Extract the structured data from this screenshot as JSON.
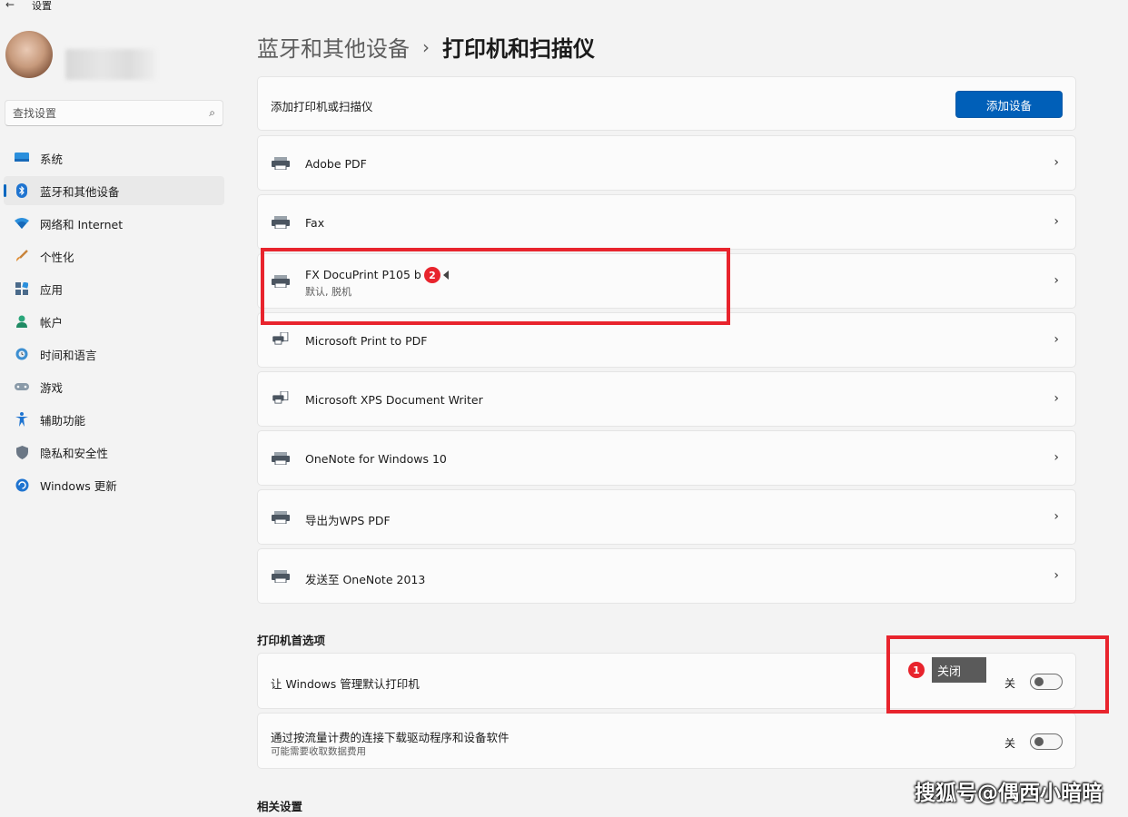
{
  "window": {
    "title": "设置"
  },
  "search": {
    "placeholder": "查找设置"
  },
  "sidebar": {
    "items": [
      {
        "label": "系统",
        "icon": "monitor-icon"
      },
      {
        "label": "蓝牙和其他设备",
        "icon": "bluetooth-icon",
        "active": true
      },
      {
        "label": "网络和 Internet",
        "icon": "wifi-icon"
      },
      {
        "label": "个性化",
        "icon": "brush-icon"
      },
      {
        "label": "应用",
        "icon": "apps-icon"
      },
      {
        "label": "帐户",
        "icon": "person-icon"
      },
      {
        "label": "时间和语言",
        "icon": "globe-clock-icon"
      },
      {
        "label": "游戏",
        "icon": "gamepad-icon"
      },
      {
        "label": "辅助功能",
        "icon": "accessibility-icon"
      },
      {
        "label": "隐私和安全性",
        "icon": "shield-icon"
      },
      {
        "label": "Windows 更新",
        "icon": "update-icon"
      }
    ]
  },
  "breadcrumb": {
    "parent": "蓝牙和其他设备",
    "separator": "›",
    "current": "打印机和扫描仪"
  },
  "add_printer": {
    "label": "添加打印机或扫描仪",
    "button": "添加设备"
  },
  "printers": [
    {
      "name": "Adobe PDF",
      "status": ""
    },
    {
      "name": "Fax",
      "status": ""
    },
    {
      "name": "FX DocuPrint P105 b",
      "status": "默认, 脱机"
    },
    {
      "name": "Microsoft Print to PDF",
      "status": ""
    },
    {
      "name": "Microsoft XPS Document Writer",
      "status": ""
    },
    {
      "name": "OneNote for Windows 10",
      "status": ""
    },
    {
      "name": "导出为WPS PDF",
      "status": ""
    },
    {
      "name": "发送至 OneNote 2013",
      "status": ""
    }
  ],
  "preferences": {
    "title": "打印机首选项",
    "manage_default": {
      "label": "让 Windows 管理默认打印机",
      "state": "关",
      "on": false
    },
    "metered": {
      "label": "通过按流量计费的连接下载驱动程序和设备软件",
      "sub": "可能需要收取数据费用",
      "state": "关",
      "on": false
    }
  },
  "related": {
    "title": "相关设置"
  },
  "annotations": {
    "badge1": "1",
    "badge2": "2",
    "tooltip": "关闭",
    "color": "#e8242d"
  },
  "watermark": "搜狐号@偶西小暗暗",
  "colors": {
    "accent": "#005fb8",
    "background": "#f3f3f3",
    "card": "#fbfbfb"
  }
}
